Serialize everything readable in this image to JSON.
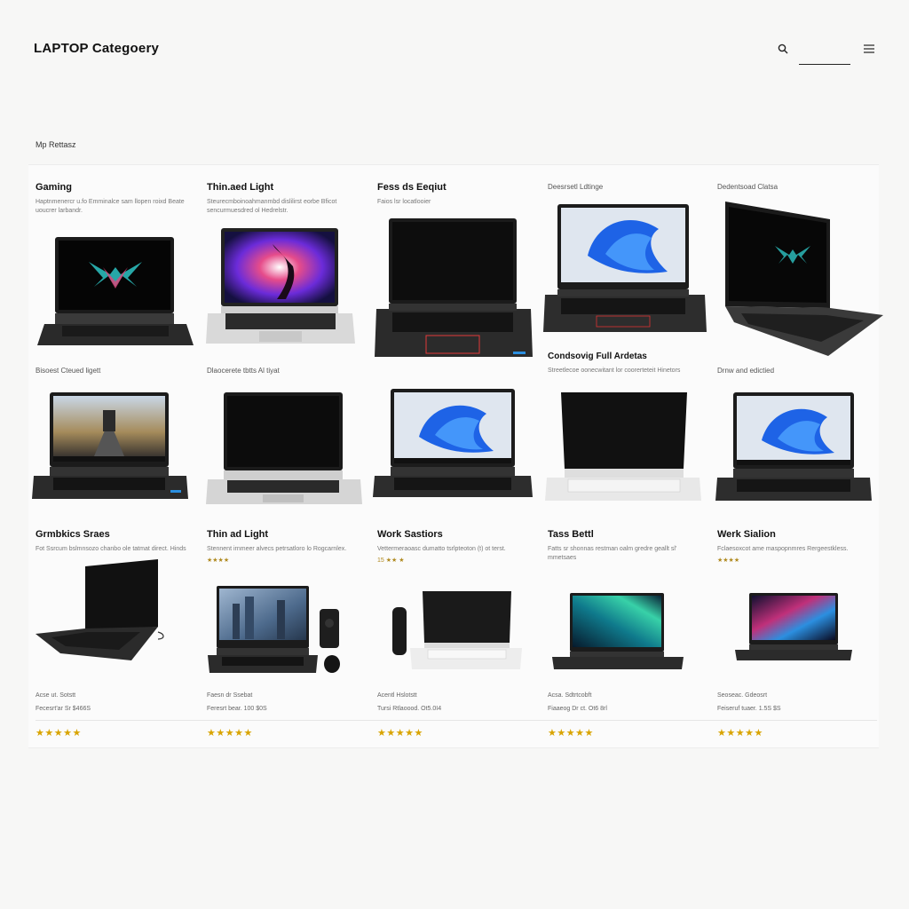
{
  "header": {
    "title": "LAPTOP Categoery",
    "search_value": ""
  },
  "section_label": "Mp Rettasz",
  "icons": {
    "search": "search-icon",
    "menu": "menu-icon"
  },
  "colors": {
    "screen_blue": "#1e63e6",
    "star": "#d9a400",
    "accent_red": "#e13a3a"
  },
  "row1": [
    {
      "title": "Gaming",
      "desc": "Haptnmenercr u.fo Emminalce sam llopen roixd Beate uoucrer larbandr.",
      "screen": "logo"
    },
    {
      "title": "Thin.aed Light",
      "desc": "Steurecmboinoahmanmbd dislilirst eorbe Bficot sencurmuesdred ol Hedrelstr.",
      "screen": "burst"
    },
    {
      "title": "Fess ds Eeqiut",
      "desc": "Faios lsr locatlooier",
      "screen": "dark"
    },
    {
      "title": "Deesrsetl Ldtinge",
      "desc": "",
      "screen": "win11"
    },
    {
      "title": "Dedentsoad Clatsa",
      "desc": "",
      "screen": "logo2"
    }
  ],
  "row2": [
    {
      "title": "Bisoest Cteued ligett",
      "desc": "",
      "screen": "road"
    },
    {
      "title": "Dlaocerete tbtts Al tiyat",
      "desc": "",
      "screen": "off"
    },
    {
      "title": "",
      "desc": "",
      "screen": "win11"
    },
    {
      "title": "Condsovig Full Ardetas",
      "desc": "Streetlecoe oonecwitant lor coorerteteit Hinetors",
      "screen": "off"
    },
    {
      "title": "Drnw and edictied",
      "desc": "",
      "screen": "win11"
    }
  ],
  "row3": [
    {
      "title": "Grmbkics Sraes",
      "desc": "Fot Ssrcum bslmnsozo chanbo ole tatmat direct. Hinds",
      "rating": "",
      "screen": "angled"
    },
    {
      "title": "Thin ad Light",
      "desc": "Stennent irnmeer alvecs petrsatloro lo Rogcarnlex.",
      "rating": "★★★★",
      "screen": "city"
    },
    {
      "title": "Work Sastiors",
      "desc": "Vettermeraoasc dumatto tsrlpteoton (t) ot terst.",
      "rating": "15 ★★ ★",
      "screen": "dark2"
    },
    {
      "title": "Tass Bettl",
      "desc": "Fatts sr shonnas restman oalm gredre geallt sl' mmetsaes",
      "rating": "",
      "screen": "aurora"
    },
    {
      "title": "Werk Sialion",
      "desc": "Fclaesoxcot ame maspopnmres Rergeestkless.",
      "rating": "★★★★",
      "screen": "neon"
    }
  ],
  "footer_items": [
    {
      "name": "Acse ut. Sotstt",
      "price": "Fecesrt'ar Sr $466S",
      "stars": "★★★★★"
    },
    {
      "name": "Faesn dr Ssebat",
      "price": "Feresrt bear. 100 $0S",
      "stars": "★★★★★"
    },
    {
      "name": "Acentl Hslotstt",
      "price": "Tursi Rtlaoood. Ot5.0I4",
      "stars": "★★★★★"
    },
    {
      "name": "Acsa. Sdtrtcobft",
      "price": "Fiaaeog Dr ct. Ot6 8rl",
      "stars": "★★★★★"
    },
    {
      "name": "Seoseac. Gdeosrt",
      "price": "Feiseruf tuaer. 1.5S $S",
      "stars": "★★★★★"
    }
  ]
}
